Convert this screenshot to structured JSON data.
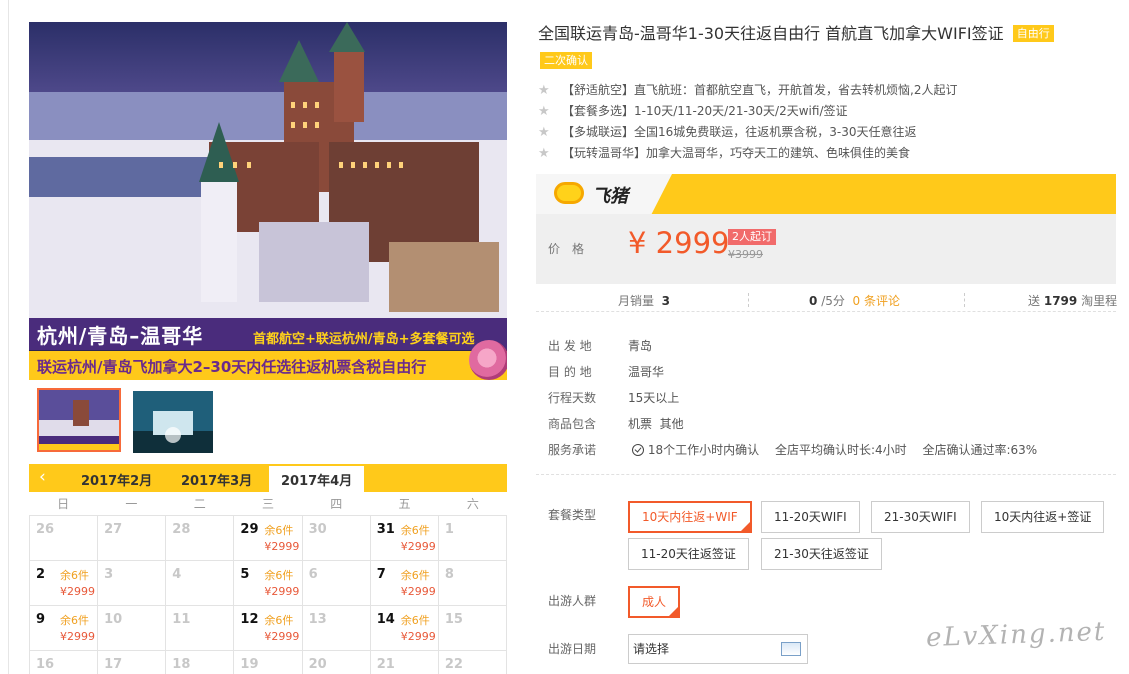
{
  "hero": {
    "route": "杭州/青岛–温哥华",
    "subtitle": "首都航空+联运杭州/青岛+多套餐可选",
    "line2": "联运杭州/青岛飞加拿大2–30天内任选往返机票含税自由行"
  },
  "calendar": {
    "prev_icon": "chevron-left-icon",
    "tabs": [
      {
        "label": "2017年2月",
        "active": false
      },
      {
        "label": "2017年3月",
        "active": false
      },
      {
        "label": "2017年4月",
        "active": true
      }
    ],
    "weekdays": [
      "日",
      "一",
      "二",
      "三",
      "四",
      "五",
      "六"
    ],
    "days": [
      {
        "day": "26",
        "stock": "",
        "price": ""
      },
      {
        "day": "27",
        "stock": "",
        "price": ""
      },
      {
        "day": "28",
        "stock": "",
        "price": ""
      },
      {
        "day": "29",
        "stock": "余6件",
        "price": "¥2999"
      },
      {
        "day": "30",
        "stock": "",
        "price": ""
      },
      {
        "day": "31",
        "stock": "余6件",
        "price": "¥2999"
      },
      {
        "day": "1",
        "stock": "",
        "price": ""
      },
      {
        "day": "2",
        "stock": "余6件",
        "price": "¥2999"
      },
      {
        "day": "3",
        "stock": "",
        "price": ""
      },
      {
        "day": "4",
        "stock": "",
        "price": ""
      },
      {
        "day": "5",
        "stock": "余6件",
        "price": "¥2999"
      },
      {
        "day": "6",
        "stock": "",
        "price": ""
      },
      {
        "day": "7",
        "stock": "余6件",
        "price": "¥2999"
      },
      {
        "day": "8",
        "stock": "",
        "price": ""
      },
      {
        "day": "9",
        "stock": "余6件",
        "price": "¥2999"
      },
      {
        "day": "10",
        "stock": "",
        "price": ""
      },
      {
        "day": "11",
        "stock": "",
        "price": ""
      },
      {
        "day": "12",
        "stock": "余6件",
        "price": "¥2999"
      },
      {
        "day": "13",
        "stock": "",
        "price": ""
      },
      {
        "day": "14",
        "stock": "余6件",
        "price": "¥2999"
      },
      {
        "day": "15",
        "stock": "",
        "price": ""
      },
      {
        "day": "16",
        "stock": "",
        "price": ""
      },
      {
        "day": "17",
        "stock": "",
        "price": ""
      },
      {
        "day": "18",
        "stock": "",
        "price": ""
      },
      {
        "day": "19",
        "stock": "",
        "price": ""
      },
      {
        "day": "20",
        "stock": "",
        "price": ""
      },
      {
        "day": "21",
        "stock": "",
        "price": ""
      },
      {
        "day": "22",
        "stock": "",
        "price": ""
      }
    ]
  },
  "product": {
    "title": "全国联运青岛-温哥华1-30天往返自由行 首航直飞加拿大WIFI签证",
    "tag_free": "自由行",
    "tag_confirm": "二次确认",
    "features": [
      "【舒适航空】直飞航班：首都航空直飞，开航首发，省去转机烦恼,2人起订",
      "【套餐多选】1-10天/11-20天/21-30天/2天wifi/签证",
      "【多城联运】全国16城免费联运，往返机票含税，3-30天任意往返",
      "【玩转温哥华】加拿大温哥华，巧夺天工的建筑、色味俱佳的美食"
    ]
  },
  "pricing": {
    "brand": "飞猪",
    "brand_icon": "fliggy-logo-icon",
    "label": "价格",
    "price": "¥ 2999",
    "badge": "2人起订",
    "old_price": "¥3999"
  },
  "stats": {
    "sales_label": "月销量",
    "sales": "3",
    "rating": "0",
    "rating_suffix": "/5分",
    "reviews": "0 条评论",
    "mileage_prefix": "送",
    "mileage": "1799",
    "mileage_suffix": "淘里程"
  },
  "info": [
    {
      "label": "出 发 地",
      "value": "青岛"
    },
    {
      "label": "目 的 地",
      "value": "温哥华"
    },
    {
      "label": "行程天数",
      "value": "15天以上"
    },
    {
      "label": "商品包含",
      "value": "机票  其他"
    }
  ],
  "promise": {
    "label": "服务承诺",
    "confirm": "18个工作小时内确认",
    "avg": "全店平均确认时长:4小时",
    "rate": "全店确认通过率:63%"
  },
  "options": {
    "package_label": "套餐类型",
    "packages": [
      "10天内往返+WIF",
      "11-20天WIFI",
      "21-30天WIFI",
      "10天内往返+签证",
      "11-20天往返签证",
      "21-30天往返签证"
    ],
    "traveler_label": "出游人群",
    "traveler": "成人",
    "date_label": "出游日期",
    "date_value": "请选择"
  },
  "watermark": "eLvXing.net"
}
